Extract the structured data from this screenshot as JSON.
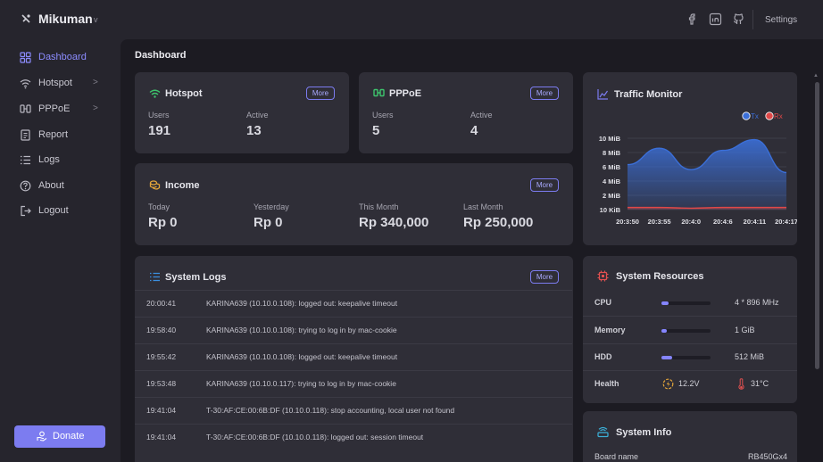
{
  "app": {
    "name": "Mikuman",
    "caret": "v",
    "settings_label": "Settings"
  },
  "icons": {
    "facebook": "facebook-icon",
    "linkedin": "linkedin-icon",
    "github": "github-icon"
  },
  "sidebar": {
    "items": [
      {
        "label": "Dashboard",
        "icon": "dashboard-icon",
        "active": true
      },
      {
        "label": "Hotspot",
        "icon": "wifi-icon",
        "chevron": ">"
      },
      {
        "label": "PPPoE",
        "icon": "network-icon",
        "chevron": ">"
      },
      {
        "label": "Report",
        "icon": "report-icon"
      },
      {
        "label": "Logs",
        "icon": "list-icon"
      },
      {
        "label": "About",
        "icon": "help-icon"
      },
      {
        "label": "Logout",
        "icon": "logout-icon"
      }
    ],
    "donate_label": "Donate"
  },
  "page": {
    "title": "Dashboard"
  },
  "hotspot": {
    "title": "Hotspot",
    "more": "More",
    "users_label": "Users",
    "users": "191",
    "active_label": "Active",
    "active": "13"
  },
  "pppoe": {
    "title": "PPPoE",
    "more": "More",
    "users_label": "Users",
    "users": "5",
    "active_label": "Active",
    "active": "4"
  },
  "income": {
    "title": "Income",
    "more": "More",
    "items": [
      {
        "label": "Today",
        "value": "Rp 0"
      },
      {
        "label": "Yesterday",
        "value": "Rp 0"
      },
      {
        "label": "This Month",
        "value": "Rp 340,000"
      },
      {
        "label": "Last Month",
        "value": "Rp 250,000"
      }
    ]
  },
  "traffic": {
    "title": "Traffic Monitor",
    "legend": [
      {
        "name": "Tx",
        "color": "#3b6fd8"
      },
      {
        "name": "Rx",
        "color": "#e04848"
      }
    ]
  },
  "chart_data": {
    "type": "area",
    "x": [
      "20:3:50",
      "20:3:55",
      "20:4:0",
      "20:4:6",
      "20:4:11",
      "20:4:17"
    ],
    "yticks": [
      "10 MiB",
      "8 MiB",
      "6 MiB",
      "4 MiB",
      "2 MiB",
      "10 KiB"
    ],
    "ylim": [
      0,
      10
    ],
    "series": [
      {
        "name": "Tx",
        "values": [
          6.3,
          8.6,
          5.6,
          8.3,
          9.8,
          5.2
        ],
        "color": "#3b6fd8"
      },
      {
        "name": "Rx",
        "values": [
          0.3,
          0.3,
          0.2,
          0.3,
          0.3,
          0.3
        ],
        "color": "#e04848"
      }
    ]
  },
  "logs": {
    "title": "System Logs",
    "more": "More",
    "rows": [
      {
        "time": "20:00:41",
        "message": "KARINA639 (10.10.0.108): logged out: keepalive timeout"
      },
      {
        "time": "19:58:40",
        "message": "KARINA639 (10.10.0.108): trying to log in by mac-cookie"
      },
      {
        "time": "19:55:42",
        "message": "KARINA639 (10.10.0.108): logged out: keepalive timeout"
      },
      {
        "time": "19:53:48",
        "message": "KARINA639 (10.10.0.117): trying to log in by mac-cookie"
      },
      {
        "time": "19:41:04",
        "message": "T-30:AF:CE:00:6B:DF (10.10.0.118): stop accounting, local user not found"
      },
      {
        "time": "19:41:04",
        "message": "T-30:AF:CE:00:6B:DF (10.10.0.118): logged out: session timeout"
      }
    ]
  },
  "resources": {
    "title": "System Resources",
    "cpu_label": "CPU",
    "cpu_value": "4 * 896 MHz",
    "cpu_usage": 0.15,
    "memory_label": "Memory",
    "memory_value": "1 GiB",
    "memory_usage": 0.1,
    "hdd_label": "HDD",
    "hdd_value": "512 MiB",
    "hdd_usage": 0.22,
    "health_label": "Health",
    "voltage": "12.2V",
    "temperature": "31°C"
  },
  "sysinfo": {
    "title": "System Info",
    "board_label": "Board name",
    "board_value": "RB450Gx4"
  }
}
